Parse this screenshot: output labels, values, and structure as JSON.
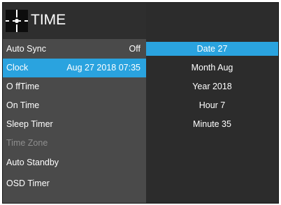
{
  "header": {
    "title": "TIME"
  },
  "menu": {
    "auto_sync": {
      "label": "Auto Sync",
      "value": "Off"
    },
    "clock": {
      "label": "Clock",
      "value": "Aug 27 2018 07:35"
    },
    "off_time": {
      "label": "O ffTime"
    },
    "on_time": {
      "label": "On Time"
    },
    "sleep_timer": {
      "label": "Sleep Timer"
    },
    "time_zone": {
      "label": "Time Zone"
    },
    "auto_standby": {
      "label": "Auto Standby"
    },
    "osd_timer": {
      "label": "OSD Timer"
    }
  },
  "clock_panel": {
    "date": "Date 27",
    "month": "Month Aug",
    "year": "Year 2018",
    "hour": "Hour  7",
    "minute": "Minute  35"
  },
  "colors": {
    "highlight": "#2aa3df",
    "left_panel": "#4a4a4a",
    "right_panel": "#2c2c2c",
    "disabled_text": "#8e8e8e"
  },
  "icons": {
    "header": "clock-crosshair-icon"
  }
}
